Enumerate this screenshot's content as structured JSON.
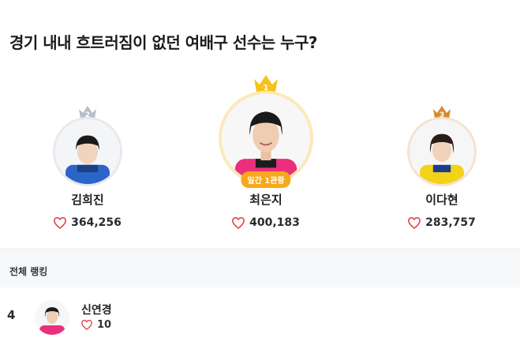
{
  "page": {
    "title": "경기 내내 흐트러짐이 없던 여배구 선수는 누구?"
  },
  "podium": [
    {
      "rank": "2",
      "name": "김희진",
      "votes": "364,256",
      "crown_color": "#b7bec8",
      "ring_color": "#e6e9ee"
    },
    {
      "rank": "1",
      "name": "최은지",
      "votes": "400,183",
      "crown_color": "#f7c31a",
      "ring_color": "#fbe9b8",
      "badge": "일간 1관왕"
    },
    {
      "rank": "3",
      "name": "이다현",
      "votes": "283,757",
      "crown_color": "#d98a2b",
      "ring_color": "#f5e3cf"
    }
  ],
  "ranking": {
    "section_title": "전체 랭킹",
    "items": [
      {
        "rank": "4",
        "name": "신연경",
        "votes": "10"
      }
    ]
  },
  "colors": {
    "heart": "#e2434b",
    "badge": "#f6a91b"
  }
}
